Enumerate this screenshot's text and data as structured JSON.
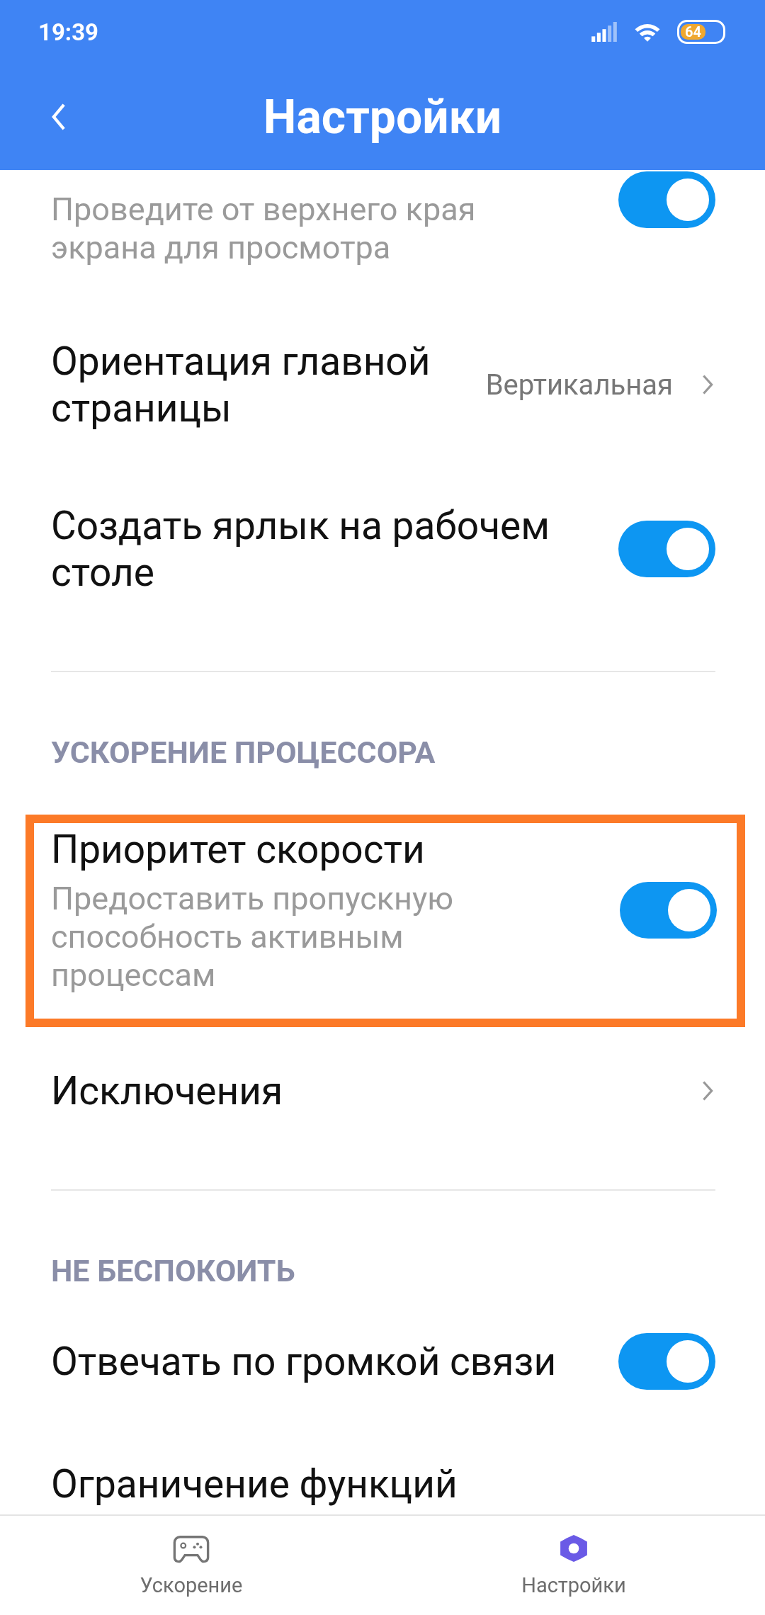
{
  "status_bar": {
    "time": "19:39",
    "battery": "64"
  },
  "toolbar": {
    "title": "Настройки"
  },
  "sections": [
    {
      "items": [
        {
          "kind": "toggle",
          "subtitle": "Проведите от верхнего края экрана для просмотра",
          "on": true
        },
        {
          "kind": "value",
          "title": "Ориентация главной страницы",
          "value": "Вертикальная"
        },
        {
          "kind": "toggle",
          "title": "Создать ярлык на рабочем столе",
          "on": true
        }
      ]
    },
    {
      "header": "УСКОРЕНИЕ ПРОЦЕССОРА",
      "items": [
        {
          "kind": "toggle",
          "title": "Приоритет скорости",
          "subtitle": "Предоставить пропускную способность активным процессам",
          "on": true,
          "highlighted": true
        },
        {
          "kind": "link",
          "title": "Исключения"
        }
      ]
    },
    {
      "header": "НЕ БЕСПОКОИТЬ",
      "items": [
        {
          "kind": "toggle",
          "title": "Отвечать по громкой связи",
          "on": true
        },
        {
          "kind": "plain",
          "title": "Ограничение функций"
        }
      ]
    }
  ],
  "bottom_nav": [
    {
      "label": "Ускорение",
      "selected": false
    },
    {
      "label": "Настройки",
      "selected": true
    }
  ]
}
